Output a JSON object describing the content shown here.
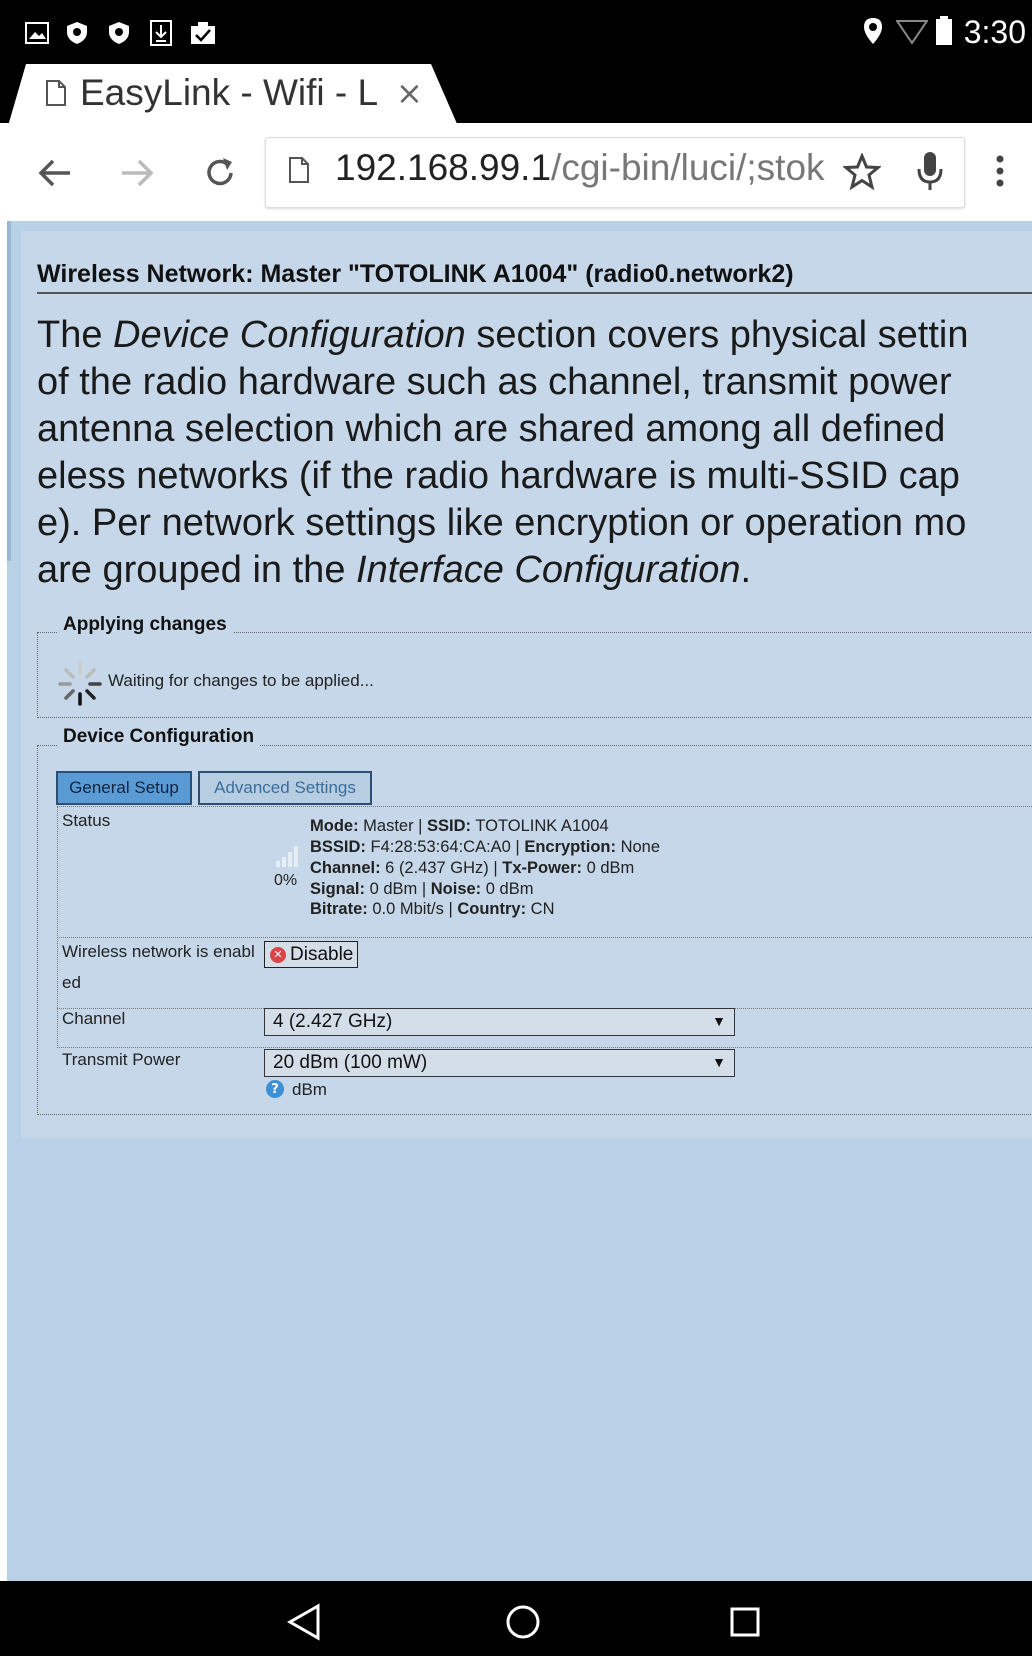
{
  "status_bar": {
    "time": "3:30",
    "left_icons": [
      "image-icon",
      "shield-icon",
      "shield-icon",
      "download-icon",
      "clipboard-check-icon"
    ],
    "right_icons": [
      "location-icon",
      "wifi-icon",
      "battery-icon"
    ]
  },
  "browser": {
    "tab_title": "EasyLink - Wifi - L",
    "tab_close": "×",
    "url_host": "192.168.99.1",
    "url_path": "/cgi-bin/luci/;stok"
  },
  "page": {
    "heading": "Wireless Network: Master \"TOTOLINK A1004\" (radio0.network2)",
    "description": {
      "line1_a": "The ",
      "line1_em": "Device Configuration",
      "line1_b": " section covers physical settin",
      "line2": "of the radio hardware such as channel, transmit power",
      "line3": "antenna selection which are shared among all defined",
      "line4": "eless networks (if the radio hardware is multi-SSID cap",
      "line5": "e). Per network settings like encryption or operation mo",
      "line6_a": "are grouped in the ",
      "line6_em": "Interface Configuration",
      "line6_b": "."
    },
    "applying": {
      "legend": "Applying changes",
      "message": "Waiting for changes to be applied..."
    },
    "device_config": {
      "legend": "Device Configuration",
      "tabs": {
        "general": "General Setup",
        "advanced": "Advanced Settings"
      },
      "status": {
        "label": "Status",
        "signal_percent": "0%",
        "mode_label": "Mode:",
        "mode": " Master | ",
        "ssid_label": "SSID:",
        "ssid": " TOTOLINK A1004",
        "bssid_label": "BSSID:",
        "bssid": " F4:28:53:64:CA:A0 | ",
        "encryption_label": "Encryption:",
        "encryption": " None",
        "channel_label": "Channel:",
        "channel": " 6 (2.437 GHz) | ",
        "txpower_label": "Tx-Power:",
        "txpower": " 0 dBm",
        "signal_label": "Signal:",
        "signal": " 0 dBm | ",
        "noise_label": "Noise:",
        "noise": " 0 dBm",
        "bitrate_label": "Bitrate:",
        "bitrate": " 0.0 Mbit/s | ",
        "country_label": "Country:",
        "country": " CN"
      },
      "enabled": {
        "label_line1": "Wireless network is enabl",
        "label_line2": "ed",
        "button": "Disable"
      },
      "channel": {
        "label": "Channel",
        "value": "4 (2.427 GHz)"
      },
      "tx_power": {
        "label": "Transmit Power",
        "value": "20 dBm (100 mW)",
        "help_unit": "dBm"
      }
    }
  },
  "nav": {
    "icons": [
      "back-triangle-icon",
      "home-circle-icon",
      "recents-square-icon"
    ]
  }
}
